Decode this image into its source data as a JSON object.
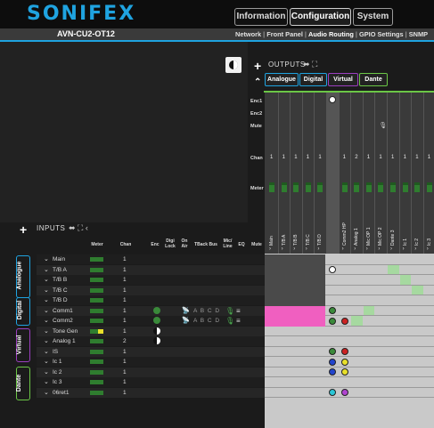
{
  "header": {
    "logo": "SONIFEX",
    "tabs": [
      {
        "label": "Information"
      },
      {
        "label": "Configuration"
      },
      {
        "label": "System"
      }
    ],
    "device_name": "AVN-CU2-OT12",
    "subnav": [
      "Network",
      "Front Panel",
      "Audio Routing",
      "GPIO Settings",
      "SNMP"
    ],
    "subnav_active": "Audio Routing"
  },
  "outputs": {
    "label": "OUTPUTS",
    "tabs": [
      "Analogue",
      "Digital",
      "Virtual",
      "Dante"
    ],
    "row_labels": [
      "Enc1",
      "Enc2",
      "Mute",
      "Chan",
      "Meter"
    ],
    "columns": [
      {
        "name": "Main",
        "chan": "1"
      },
      {
        "name": "T/B A",
        "chan": "1"
      },
      {
        "name": "T/B B",
        "chan": "1"
      },
      {
        "name": "T/B C",
        "chan": "1"
      },
      {
        "name": "T/B D",
        "chan": "1"
      },
      {
        "name": "Comm1 HP",
        "chan": "2"
      },
      {
        "name": "Comm2 HP",
        "chan": "1"
      },
      {
        "name": "Analog 1",
        "chan": "2"
      },
      {
        "name": "Mic OP 1",
        "chan": "1"
      },
      {
        "name": "Mic OP 2",
        "chan": "1"
      },
      {
        "name": "Dante 3",
        "chan": "1"
      },
      {
        "name": "Ic 1",
        "chan": "1"
      },
      {
        "name": "Ic 2",
        "chan": "1"
      },
      {
        "name": "Ic 3",
        "chan": "1"
      }
    ]
  },
  "inputs": {
    "label": "INPUTS",
    "column_headers": [
      "Meter",
      "Chan",
      "Enc",
      "Digi Lock",
      "On Air",
      "TBack Bus",
      "Mic/ Line",
      "EQ",
      "Mute"
    ],
    "side_tabs": [
      "Analogue",
      "Digital",
      "Virtual",
      "Dante"
    ],
    "rows": [
      {
        "name": "Main",
        "chan": "1",
        "tbk": ""
      },
      {
        "name": "T/B A",
        "chan": "1",
        "tbk": ""
      },
      {
        "name": "T/B B",
        "chan": "1",
        "tbk": ""
      },
      {
        "name": "T/B C",
        "chan": "1",
        "tbk": ""
      },
      {
        "name": "T/B D",
        "chan": "1",
        "tbk": ""
      },
      {
        "name": "Comm1",
        "chan": "1",
        "tbk": "A B C D"
      },
      {
        "name": "Comm2",
        "chan": "1",
        "tbk": "A B C D"
      },
      {
        "name": "Tone Gen",
        "chan": "1",
        "tbk": ""
      },
      {
        "name": "Analog 1",
        "chan": "2",
        "tbk": ""
      },
      {
        "name": "IS",
        "chan": "1",
        "tbk": ""
      },
      {
        "name": "Ic 1",
        "chan": "1",
        "tbk": ""
      },
      {
        "name": "Ic 2",
        "chan": "1",
        "tbk": ""
      },
      {
        "name": "Ic 3",
        "chan": "1",
        "tbk": ""
      },
      {
        "name": "06ret1",
        "chan": "1",
        "tbk": ""
      }
    ]
  },
  "colors": {
    "brand": "#1fa3e0",
    "analogue": "#1fa3e0",
    "digital": "#1fa3e0",
    "virtual": "#9b3fbf",
    "dante": "#6bc646",
    "pink": "#f05fc0"
  }
}
